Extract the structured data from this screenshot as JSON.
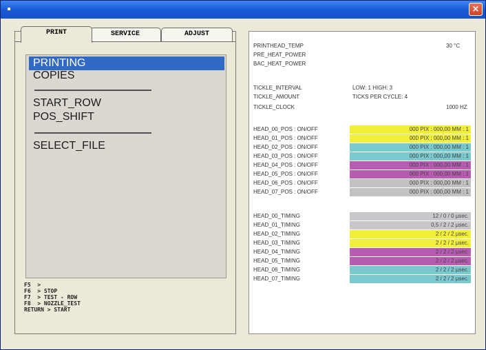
{
  "window": {
    "close_label": "×"
  },
  "tabs": [
    "PRINT",
    "SERVICE",
    "ADJUST"
  ],
  "menu": {
    "items": [
      "PRINTING",
      "COPIES",
      "START_ROW",
      "POS_SHIFT",
      "SELECT_FILE"
    ],
    "selected": "PRINTING"
  },
  "keys": [
    "F5  >",
    "F6  > STOP",
    "F7  > TEST - ROW",
    "F8  > NOZZLE_TEST",
    "RETURN > START"
  ],
  "status": {
    "printhead_temp_label": "PRINTHEAD_TEMP",
    "printhead_temp_value": "30 °C",
    "pre_heat_label": "PRE_HEAT_POWER",
    "bac_heat_label": "BAC_HEAT_POWER",
    "tickle_interval_label": "TICKLE_INTERVAL",
    "tickle_interval_value": "LOW: 1   HIGH: 3",
    "tickle_amount_label": "TICKLE_AMOUNT",
    "tickle_amount_value": "TICKS PER CYCLE: 4",
    "tickle_clock_label": "TICKLE_CLOCK",
    "tickle_clock_value": "1000 HZ"
  },
  "head_pos": [
    {
      "label": "HEAD_00_POS : ON/OFF",
      "value": "000 PIX : 000,00 MM : 1",
      "color": "#f2ef3b"
    },
    {
      "label": "HEAD_01_POS : ON/OFF",
      "value": "000 PIX : 000,00 MM : 1",
      "color": "#f2ef3b"
    },
    {
      "label": "HEAD_02_POS : ON/OFF",
      "value": "000 PIX : 000,00 MM : 1",
      "color": "#79c9cf"
    },
    {
      "label": "HEAD_03_POS : ON/OFF",
      "value": "000 PIX : 000,00 MM : 1",
      "color": "#79c9cf"
    },
    {
      "label": "HEAD_04_POS : ON/OFF",
      "value": "000 PIX : 000,00 MM : 1",
      "color": "#b85bb2"
    },
    {
      "label": "HEAD_05_POS : ON/OFF",
      "value": "000 PIX : 000,00 MM : 1",
      "color": "#b85bb2"
    },
    {
      "label": "HEAD_06_POS : ON/OFF",
      "value": "000 PIX : 000,00 MM : 1",
      "color": "#c2c2c2"
    },
    {
      "label": "HEAD_07_POS : ON/OFF",
      "value": "000 PIX : 000,00 MM : 1",
      "color": "#c2c2c2"
    }
  ],
  "head_timing": [
    {
      "label": "HEAD_00_TIMING",
      "value": "12 / 0 / 0   µsec.",
      "color": "#c8c8cc"
    },
    {
      "label": "HEAD_01_TIMING",
      "value": "0,5 / 2 / 2   µsec.",
      "color": "#c8c8cc"
    },
    {
      "label": "HEAD_02_TIMING",
      "value": "2 / 2 / 2   µsec.",
      "color": "#f2ef3b"
    },
    {
      "label": "HEAD_03_TIMING",
      "value": "2 / 2 / 2   µsec.",
      "color": "#f2ef3b"
    },
    {
      "label": "HEAD_04_TIMING",
      "value": "2 / 2 / 2   µsec.",
      "color": "#b85bb2"
    },
    {
      "label": "HEAD_05_TIMING",
      "value": "2 / 2 / 2   µsec.",
      "color": "#b85bb2"
    },
    {
      "label": "HEAD_06_TIMING",
      "value": "2 / 2 / 2   µsec.",
      "color": "#79c9cf"
    },
    {
      "label": "HEAD_07_TIMING",
      "value": "2 / 2 / 2   µsec.",
      "color": "#79c9cf"
    }
  ]
}
